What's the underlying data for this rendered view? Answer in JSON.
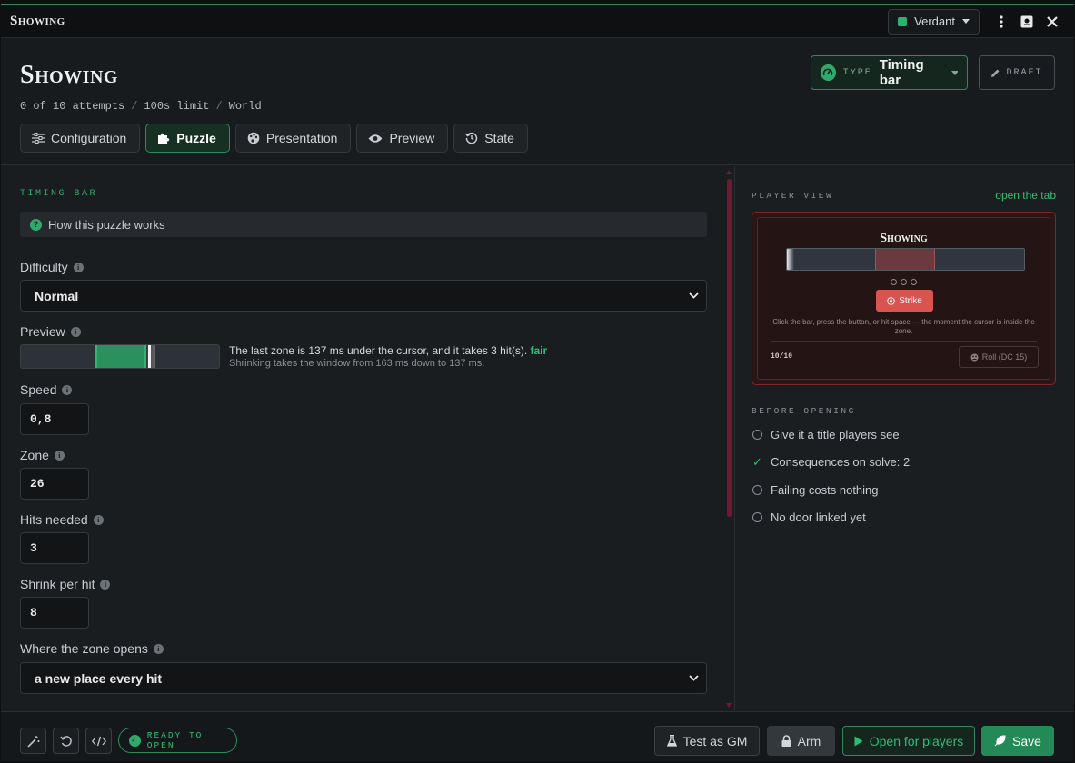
{
  "window": {
    "title": "Showing",
    "theme": "Verdant",
    "theme_color": "#29b46f"
  },
  "header": {
    "title": "Showing",
    "meta": {
      "attempts": "0 of 10 attempts",
      "limit": "100s limit",
      "scope": "World",
      "separator": "/"
    },
    "type": {
      "label": "TYPE",
      "value": "Timing bar"
    },
    "draft_label": "DRAFT",
    "tabs": [
      {
        "label": "Configuration",
        "icon": "sliders-icon"
      },
      {
        "label": "Puzzle",
        "icon": "puzzle-icon",
        "active": true
      },
      {
        "label": "Presentation",
        "icon": "palette-icon"
      },
      {
        "label": "Preview",
        "icon": "eye-icon"
      },
      {
        "label": "State",
        "icon": "history-icon"
      }
    ]
  },
  "puzzle": {
    "section_title": "TIMING BAR",
    "howto": "How this puzzle works",
    "difficulty": {
      "label": "Difficulty",
      "value": "Normal"
    },
    "preview": {
      "label": "Preview",
      "description": "The last zone is 137 ms under the cursor, and it takes 3 hit(s).",
      "rating": "fair",
      "detail": "Shrinking takes the window from 163 ms down to 137 ms."
    },
    "speed": {
      "label": "Speed",
      "value": "0,8"
    },
    "zone": {
      "label": "Zone",
      "value": "26"
    },
    "hits": {
      "label": "Hits needed",
      "value": "3"
    },
    "shrink": {
      "label": "Shrink per hit",
      "value": "8"
    },
    "opens": {
      "label": "Where the zone opens",
      "value": "a new place every hit"
    }
  },
  "player_view": {
    "label": "PLAYER VIEW",
    "open_tab": "open the tab",
    "card": {
      "title": "Showing",
      "strike": "Strike",
      "hint": "Click the bar, press the button, or hit space — the moment the cursor is inside the zone.",
      "count": "10/10",
      "roll": "Roll (DC 15)"
    }
  },
  "before_opening": {
    "label": "BEFORE OPENING",
    "items": [
      {
        "text": "Give it a title players see",
        "done": false
      },
      {
        "text": "Consequences on solve: 2",
        "done": true
      },
      {
        "text": "Failing costs nothing",
        "done": false
      },
      {
        "text": "No door linked yet",
        "done": false
      }
    ]
  },
  "footer": {
    "status": "READY TO OPEN",
    "test": "Test as GM",
    "arm": "Arm",
    "open": "Open for players",
    "save": "Save"
  }
}
